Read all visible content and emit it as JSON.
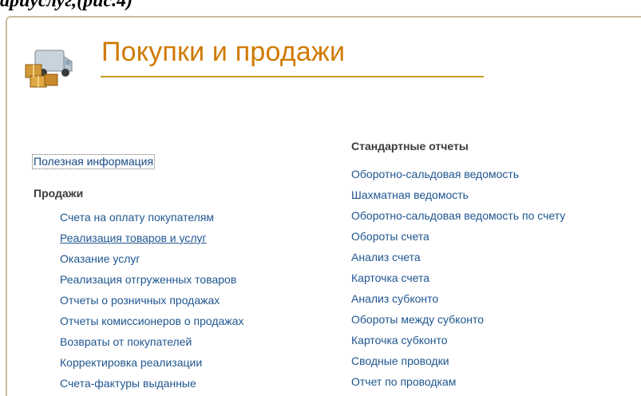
{
  "doc_fragment": "ариуслуг,(рис.4)",
  "panel": {
    "title": "Покупки и продажи",
    "icon": "delivery-truck-boxes-icon",
    "accent_color": "#d07a00"
  },
  "left": {
    "useful_link": "Полезная информация",
    "sales_heading": "Продажи",
    "sales_links": [
      "Счета на оплату покупателям",
      "Реализация товаров и услуг",
      "Оказание услуг",
      "Реализация отгруженных товаров",
      "Отчеты о розничных продажах",
      "Отчеты комиссионеров о продажах",
      "Возвраты от покупателей",
      "Корректировка реализации",
      "Счета-фактуры выданные"
    ]
  },
  "right": {
    "reports_heading": "Стандартные отчеты",
    "report_links": [
      "Оборотно-сальдовая ведомость",
      "Шахматная ведомость",
      "Оборотно-сальдовая ведомость по счету",
      "Обороты счета",
      "Анализ счета",
      "Карточка счета",
      "Анализ субконто",
      "Обороты между субконто",
      "Карточка субконто",
      "Сводные проводки",
      "Отчет по проводкам"
    ]
  }
}
